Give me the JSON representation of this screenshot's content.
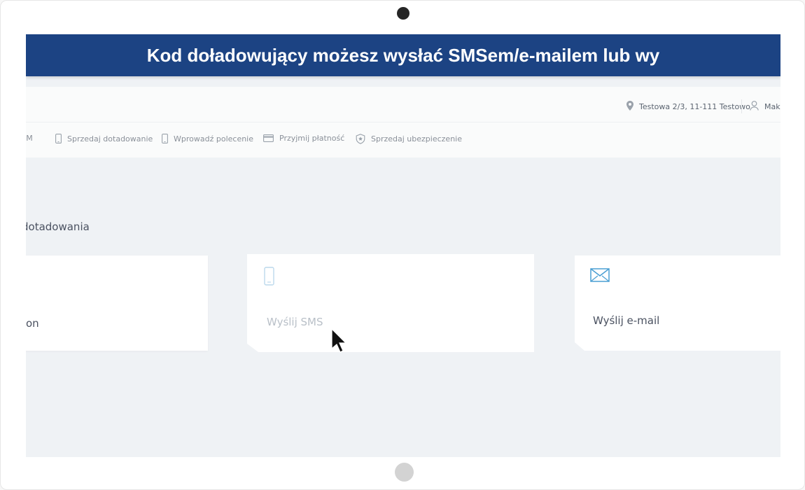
{
  "caption": "Kod doładowujący możesz wysłać SMSem/e-mailem lub wy",
  "header": {
    "address": "Testowa 2/3, 11-111 Testowo",
    "user_name": "Maks"
  },
  "nav": {
    "items": [
      {
        "label": "SIM",
        "icon": "sim-icon"
      },
      {
        "label": "Sprzedaj dotadowanie",
        "icon": "phone-icon"
      },
      {
        "label": "Wprowadź polecenie",
        "icon": "phone-icon"
      },
      {
        "label": "Przyjmij płatność",
        "icon": "credit-card-icon"
      },
      {
        "label": "Sprzedaj ubezpieczenie",
        "icon": "shield-star-icon"
      }
    ]
  },
  "section_title": "dotadowania",
  "options": [
    {
      "label": "on",
      "icon": ""
    },
    {
      "label": "Wyślij SMS",
      "icon": "mobile-phone-icon"
    },
    {
      "label": "Wyślij e-mail",
      "icon": "envelope-icon"
    }
  ],
  "colors": {
    "banner": "#1c4383",
    "accent_icon": "#4a9fd3",
    "label_dark": "#4a5160",
    "label_faded": "#b9c0c8"
  }
}
